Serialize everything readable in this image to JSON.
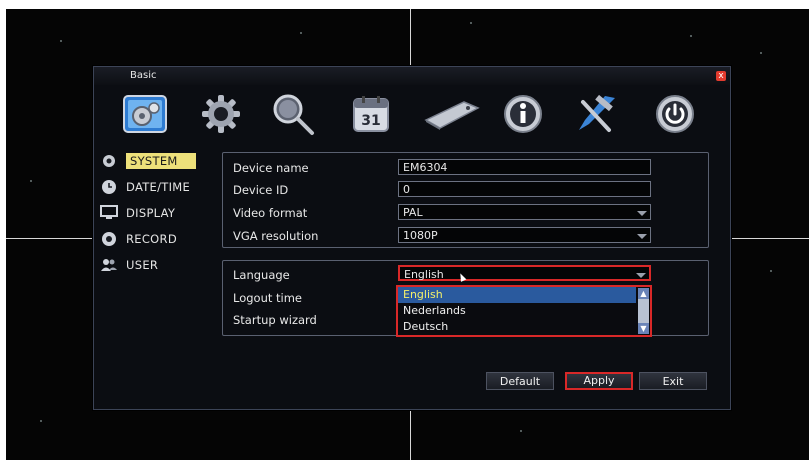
{
  "dialog": {
    "title": "Basic",
    "close_glyph": "x"
  },
  "toolbar": {
    "icons": [
      "basic-config-icon",
      "gear-icon",
      "search-icon",
      "calendar-icon",
      "disk-icon",
      "info-icon",
      "tools-icon",
      "power-icon"
    ],
    "calendar_text": "31"
  },
  "sidebar": {
    "items": [
      {
        "label": "SYSTEM",
        "icon": "gear-icon"
      },
      {
        "label": "DATE/TIME",
        "icon": "clock-icon"
      },
      {
        "label": "DISPLAY",
        "icon": "monitor-icon"
      },
      {
        "label": "RECORD",
        "icon": "record-icon"
      },
      {
        "label": "USER",
        "icon": "users-icon"
      }
    ]
  },
  "system": {
    "device_name_label": "Device name",
    "device_name_value": "EM6304",
    "device_id_label": "Device ID",
    "device_id_value": "0",
    "video_format_label": "Video format",
    "video_format_value": "PAL",
    "vga_resolution_label": "VGA resolution",
    "vga_resolution_value": "1080P",
    "language_label": "Language",
    "language_value": "English",
    "logout_time_label": "Logout time",
    "startup_wizard_label": "Startup wizard"
  },
  "language_dropdown": {
    "options": [
      "English",
      "Nederlands",
      "Deutsch"
    ]
  },
  "buttons": {
    "default": "Default",
    "apply": "Apply",
    "exit": "Exit"
  },
  "colors": {
    "accent_red": "#d92828",
    "selected_bg": "#2a5a9e",
    "selected_text": "#f4f06a",
    "sidebar_active": "#ede07a"
  }
}
